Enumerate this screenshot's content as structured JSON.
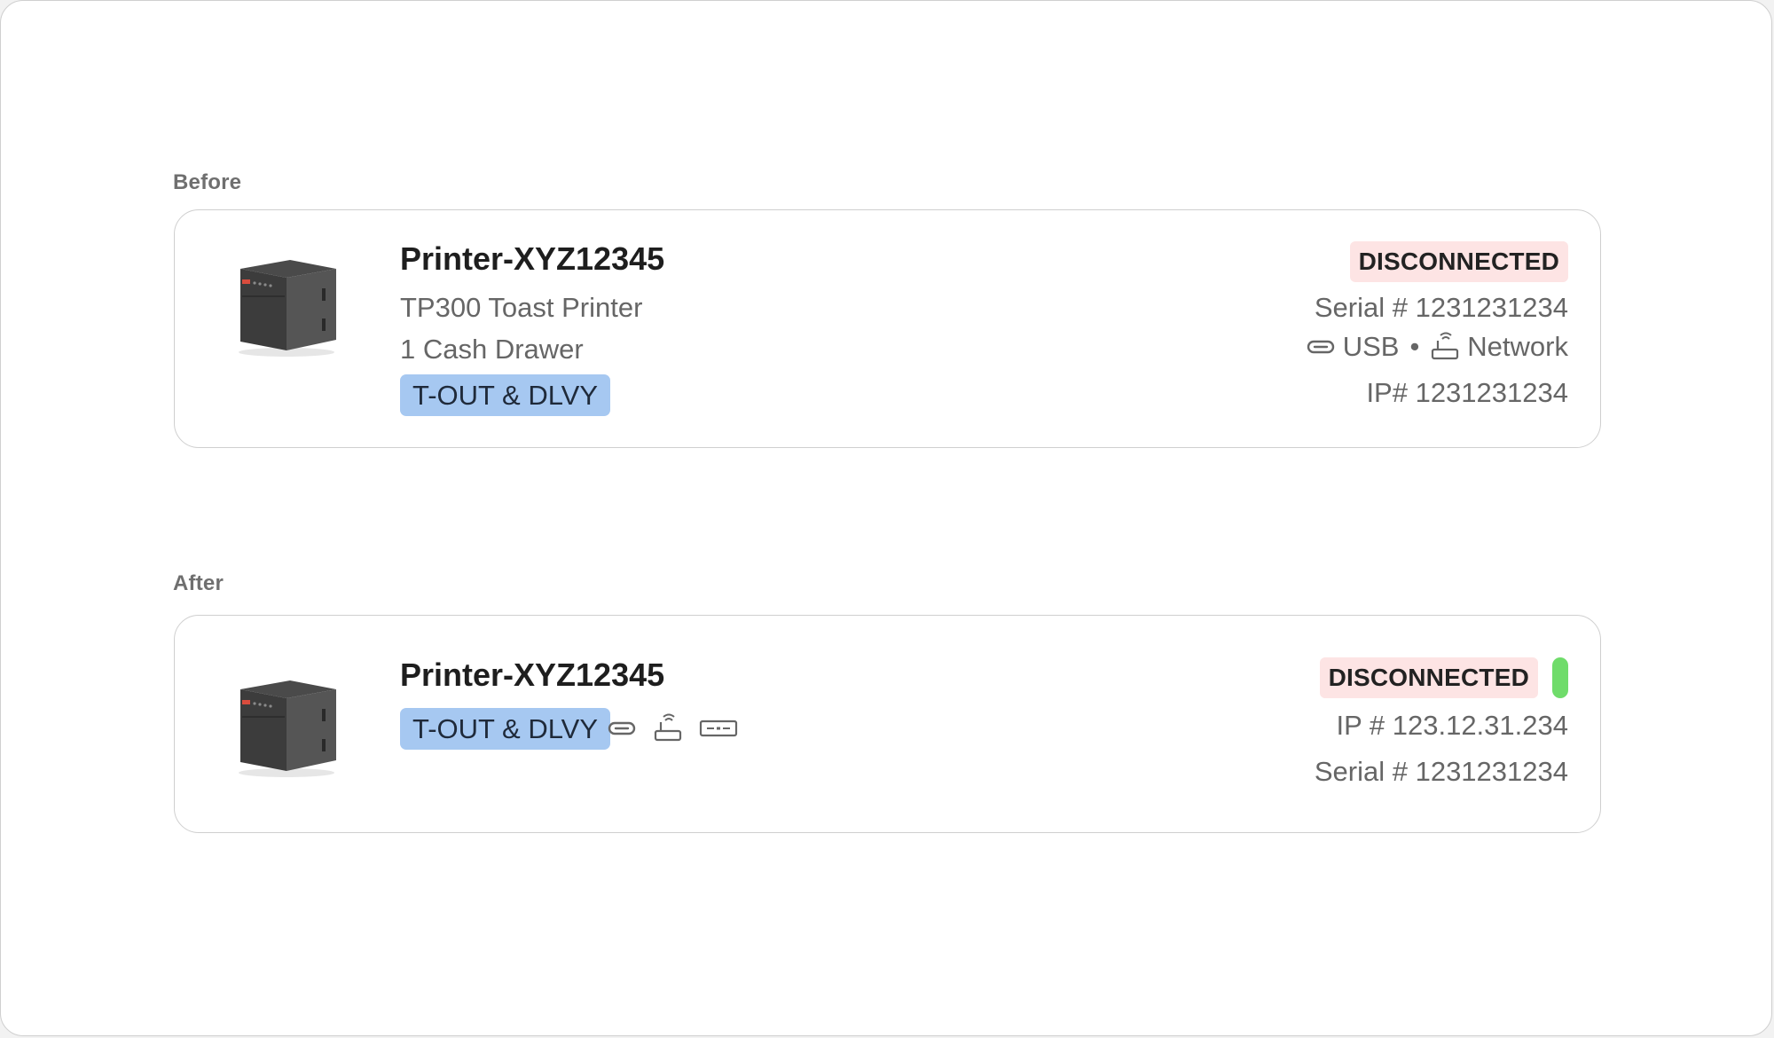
{
  "before": {
    "section_label": "Before",
    "printer": {
      "name": "Printer-XYZ12345",
      "model": "TP300 Toast Printer",
      "cash_drawer": "1 Cash Drawer",
      "tag": "T-OUT & DLVY",
      "status": "DISCONNECTED",
      "serial": "Serial # 1231231234",
      "conn_usb": "USB",
      "conn_separator": "•",
      "conn_network": "Network",
      "ip": "IP# 1231231234"
    }
  },
  "after": {
    "section_label": "After",
    "printer": {
      "name": "Printer-XYZ12345",
      "tag": "T-OUT & DLVY",
      "status": "DISCONNECTED",
      "ip": "IP # 123.12.31.234",
      "serial": "Serial # 1231231234",
      "connection_icons": [
        "usb-icon",
        "network-router-icon",
        "cash-drawer-icon"
      ],
      "indicator_color": "#6fdc6a"
    }
  },
  "colors": {
    "tag_bg": "#a6c8f1",
    "status_bg": "#fde4e4"
  }
}
